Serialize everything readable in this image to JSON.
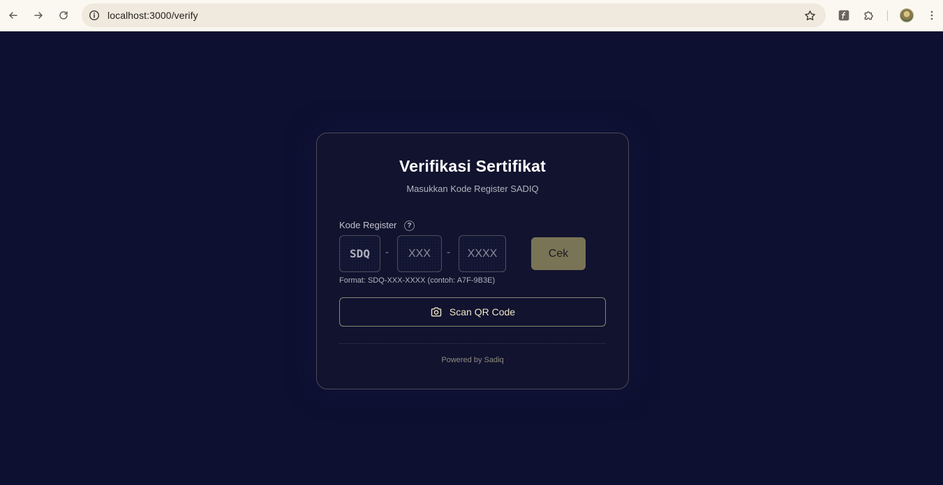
{
  "browser": {
    "url": "localhost:3000/verify",
    "icons": {
      "back": "arrow-left-icon",
      "forward": "arrow-right-icon",
      "reload": "reload-icon",
      "info": "info-icon",
      "bookmark": "star-icon",
      "extension_f": "font-extension-icon",
      "extensions": "puzzle-icon",
      "menu": "kebab-menu-icon"
    }
  },
  "card": {
    "title": "Verifikasi Sertifikat",
    "subtitle": "Masukkan Kode Register SADIQ",
    "field_label": "Kode Register",
    "help": "?",
    "prefix": "SDQ",
    "separator": "-",
    "input_mid_placeholder": "XXX",
    "input_end_placeholder": "XXXX",
    "check_button": "Cek",
    "format_hint": "Format: SDQ-XXX-XXXX (contoh: A7F-9B3E)",
    "scan_button": "Scan QR Code",
    "footer": "Powered by Sadiq"
  },
  "colors": {
    "page_bg": "#0d1030",
    "card_border": "#4b4a55",
    "accent_button": "#7a7456",
    "scan_text": "#f2e7c4"
  }
}
